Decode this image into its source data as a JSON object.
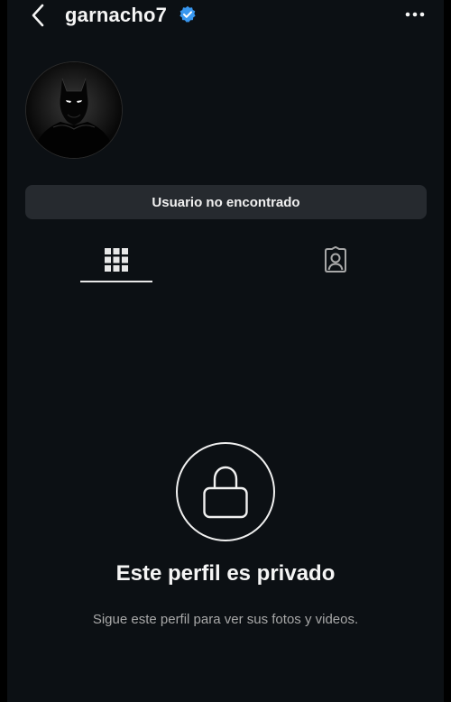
{
  "header": {
    "username": "garnacho7",
    "back_icon": "chevron-left-icon",
    "verified_icon": "verified-badge-icon",
    "more_icon": "more-horizontal-icon"
  },
  "profile": {
    "avatar_description_icon": "batman-avatar",
    "status_message": "Usuario no encontrado"
  },
  "tabs": [
    {
      "icon": "grid-icon",
      "active": true
    },
    {
      "icon": "tagged-person-icon",
      "active": false
    }
  ],
  "private": {
    "icon": "lock-icon",
    "title": "Este perfil es privado",
    "subtitle": "Sigue este perfil para ver sus fotos y videos."
  },
  "colors": {
    "background": "#0c1014",
    "verified_blue": "#3897f0",
    "pill_background": "#262a2f",
    "text_primary": "#f5f5f5",
    "text_secondary": "#a8a8a8"
  }
}
